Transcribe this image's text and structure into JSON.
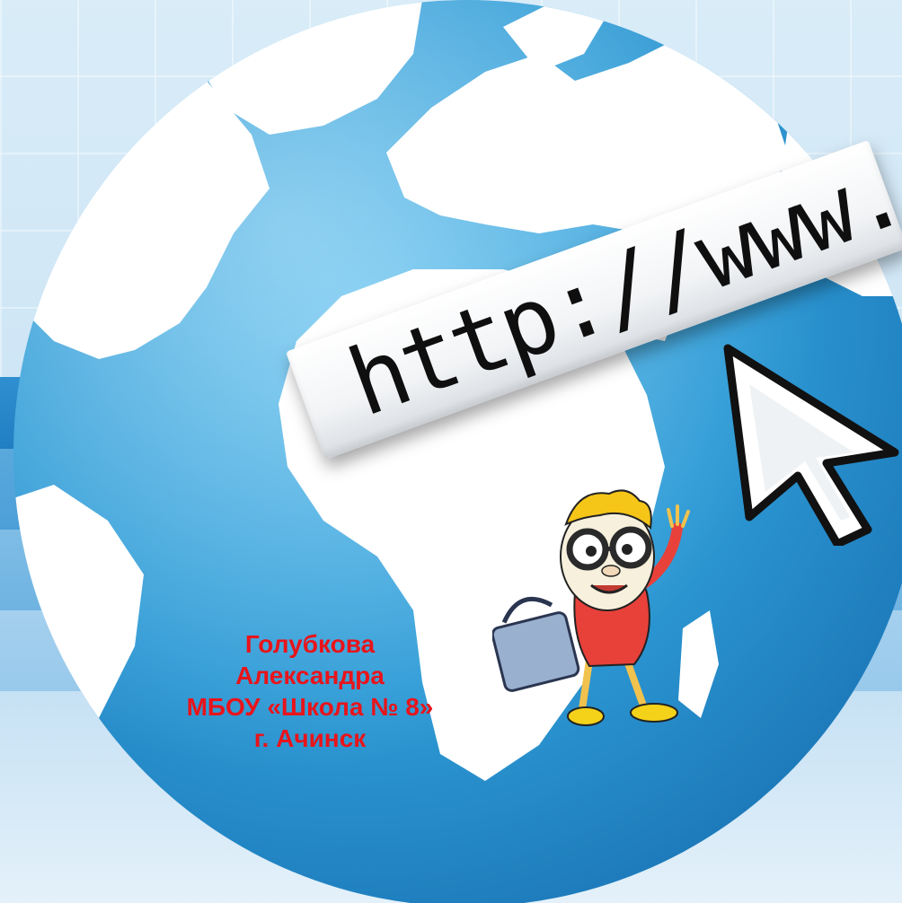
{
  "banner": {
    "url_text": "http://www."
  },
  "credit": {
    "line1": "Голубкова",
    "line2": "Александра",
    "line3": "МБОУ «Школа № 8»",
    "line4": "г. Ачинск"
  },
  "colors": {
    "ocean": "#2e9bd6",
    "land": "#ffffff",
    "credit_text": "#e8141b",
    "background": "#d9ecf8"
  },
  "icons": {
    "cursor": "arrow-cursor-icon",
    "mascot": "cartoon-egg-mascot"
  }
}
